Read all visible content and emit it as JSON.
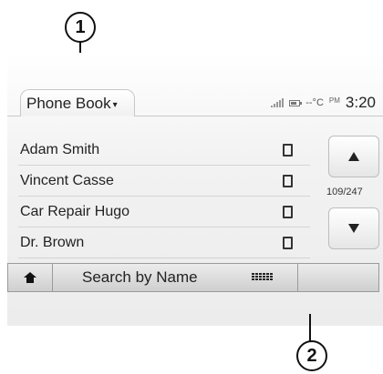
{
  "callouts": {
    "one": "1",
    "two": "2"
  },
  "header": {
    "title": "Phone Book"
  },
  "status": {
    "temperature": "--°C",
    "ampm": "PM",
    "time": "3:20"
  },
  "contacts": [
    {
      "name": "Adam Smith"
    },
    {
      "name": "Vincent Casse"
    },
    {
      "name": "Car Repair Hugo"
    },
    {
      "name": "Dr. Brown"
    }
  ],
  "pagination": {
    "counter": "109/247"
  },
  "toolbar": {
    "search_label": "Search by Name"
  },
  "icons": {
    "home": "home-icon",
    "keyboard": "keyboard-icon",
    "phone": "phone-icon",
    "scroll_up": "triangle-up-icon",
    "scroll_down": "triangle-down-icon",
    "signal": "signal-icon",
    "battery": "battery-icon",
    "dropdown": "chevron-down-icon"
  }
}
